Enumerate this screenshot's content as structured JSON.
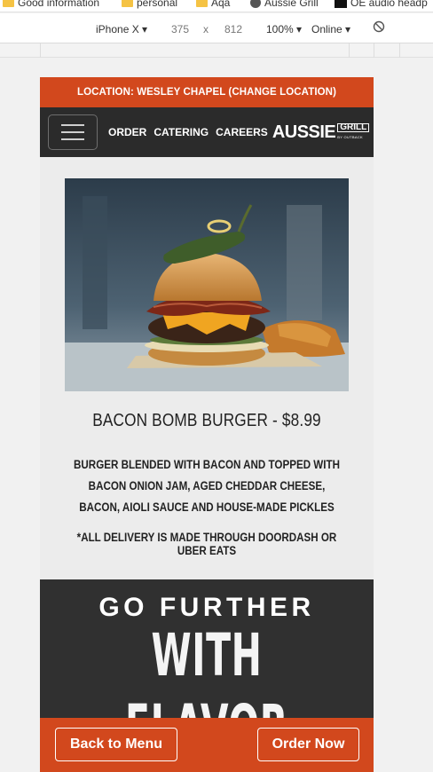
{
  "bookmarks": [
    {
      "label": "Good information",
      "icon": "folder-icon"
    },
    {
      "label": "personal",
      "icon": "folder-icon"
    },
    {
      "label": "Aqa",
      "icon": "folder-icon"
    },
    {
      "label": "Aussie Grill",
      "icon": "globe-icon"
    },
    {
      "label": "OE audio headp",
      "icon": "oe-icon"
    }
  ],
  "devtools": {
    "device": "iPhone X",
    "width": "375",
    "times": "x",
    "height": "812",
    "zoom": "100%",
    "network": "Online"
  },
  "page": {
    "location_bar": "LOCATION: WESLEY CHAPEL (CHANGE LOCATION)",
    "nav": {
      "links": [
        "ORDER",
        "CATERING",
        "CAREERS"
      ],
      "logo_main": "AUSSIE",
      "logo_grill": "GRILL",
      "logo_sub": "BY OUTBACK"
    },
    "item": {
      "title": "BACON BOMB BURGER - $8.99",
      "description": "BURGER BLENDED WITH BACON AND TOPPED WITH BACON ONION JAM, AGED CHEDDAR CHEESE, BACON, AIOLI SAUCE AND HOUSE-MADE PICKLES",
      "note": "*ALL DELIVERY IS MADE THROUGH DOORDASH OR UBER EATS"
    },
    "banner": {
      "line1": "GO FURTHER",
      "line2": "WITH FLAVOR"
    },
    "footer": {
      "back_label": "Back to Menu",
      "order_label": "Order Now"
    }
  },
  "colors": {
    "brand_orange": "#d2481d",
    "nav_dark": "#2b2b2b",
    "banner_dark": "#303030"
  }
}
